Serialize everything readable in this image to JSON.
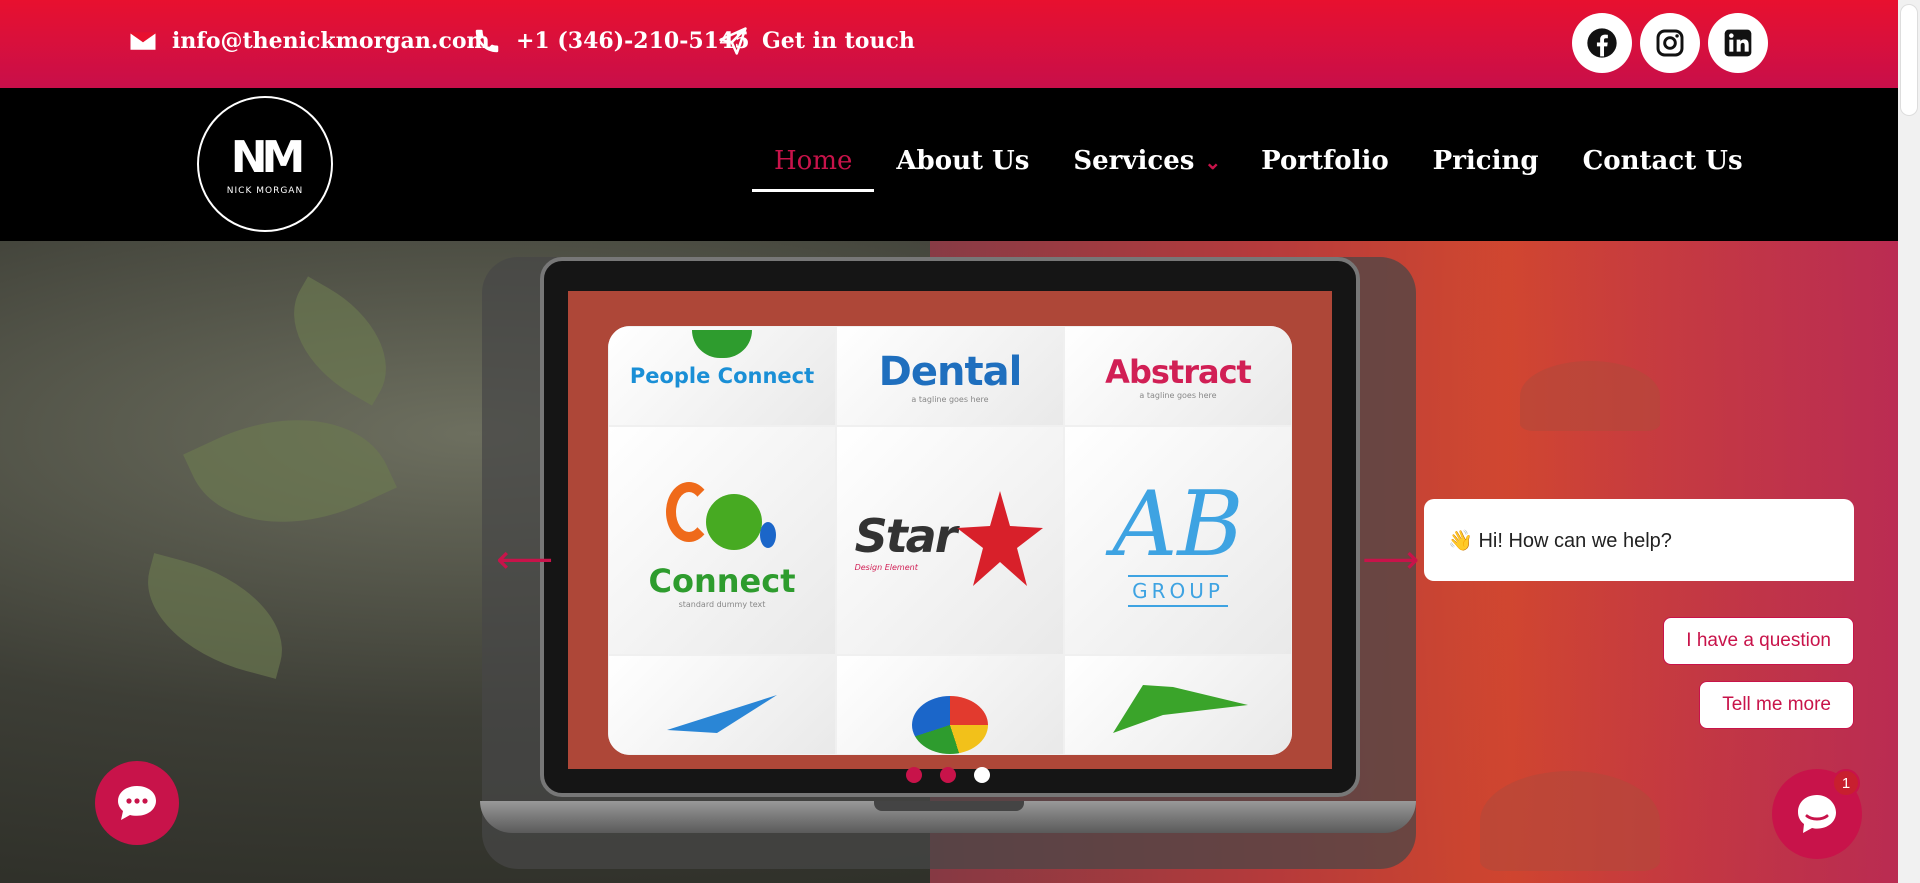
{
  "topbar": {
    "email": "info@thenickmorgan.com",
    "phone": "+1 (346)-210-5145",
    "cta": "Get in touch",
    "socials": [
      "facebook-icon",
      "instagram-icon",
      "linkedin-icon"
    ]
  },
  "brand": {
    "monogram": "NM",
    "name": "NICK MORGAN"
  },
  "nav": {
    "items": [
      {
        "label": "Home",
        "active": true
      },
      {
        "label": "About Us"
      },
      {
        "label": "Services",
        "dropdown": true
      },
      {
        "label": "Portfolio"
      },
      {
        "label": "Pricing"
      },
      {
        "label": "Contact Us"
      }
    ]
  },
  "slider": {
    "logos": [
      {
        "title": "People Connect",
        "color": "#1a8fd6"
      },
      {
        "title": "Dental",
        "tagline": "a tagline goes here",
        "color": "#1f6fbe"
      },
      {
        "title": "Abstract",
        "tagline": "a tagline goes here",
        "color": "#d11f55"
      },
      {
        "title": "Connect",
        "tagline": "standard dummy text",
        "color": "#2e9c2e"
      },
      {
        "title": "Star",
        "tagline": "Design Element",
        "color": "#333333"
      },
      {
        "title": "AB",
        "tagline": "GROUP",
        "color": "#3ea3e2"
      }
    ],
    "dots": 3,
    "current_dot": 3
  },
  "chat": {
    "greeting": "👋 Hi! How can we help?",
    "options": [
      "I have a question",
      "Tell me more"
    ],
    "badge_count": "1"
  },
  "colors": {
    "accent": "#c8134a",
    "topbar": "#e8102f"
  }
}
